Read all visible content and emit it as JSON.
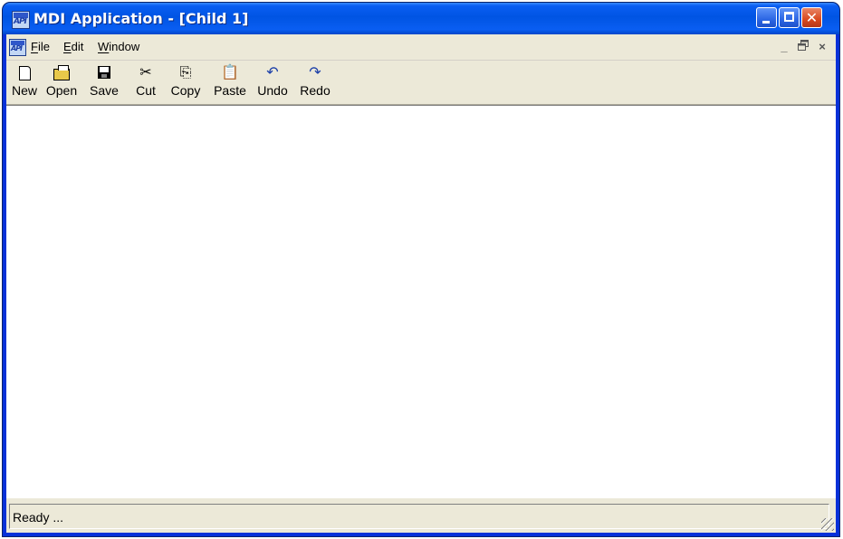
{
  "window": {
    "title": "MDI Application - [Child 1]",
    "app_icon": "api-app-icon",
    "caption_buttons": {
      "minimize": "minimize-icon",
      "maximize": "maximize-icon",
      "close": "close-icon"
    },
    "close_glyph": "✕"
  },
  "menubar": {
    "items": [
      {
        "mnemonic": "F",
        "rest": "ile"
      },
      {
        "mnemonic": "E",
        "rest": "dit"
      },
      {
        "mnemonic": "W",
        "rest": "indow"
      }
    ],
    "mdi_controls": {
      "minimize": "_",
      "restore": "🗗",
      "close": "×"
    }
  },
  "toolbar": {
    "buttons": [
      {
        "label": "New",
        "icon": "new-document-icon"
      },
      {
        "label": "Open",
        "icon": "open-folder-icon"
      },
      {
        "label": "Save",
        "icon": "save-disk-icon"
      },
      {
        "label": "Cut",
        "icon": "scissors-icon",
        "glyph": "✂"
      },
      {
        "label": "Copy",
        "icon": "copy-icon",
        "glyph": "⎘"
      },
      {
        "label": "Paste",
        "icon": "paste-icon",
        "glyph": "📋"
      },
      {
        "label": "Undo",
        "icon": "undo-icon",
        "glyph": "↶"
      },
      {
        "label": "Redo",
        "icon": "redo-icon",
        "glyph": "↷"
      }
    ]
  },
  "statusbar": {
    "text": "Ready ..."
  },
  "colors": {
    "title_bar": "#0054e3",
    "close_button": "#d9491f",
    "face": "#ece9d8"
  }
}
